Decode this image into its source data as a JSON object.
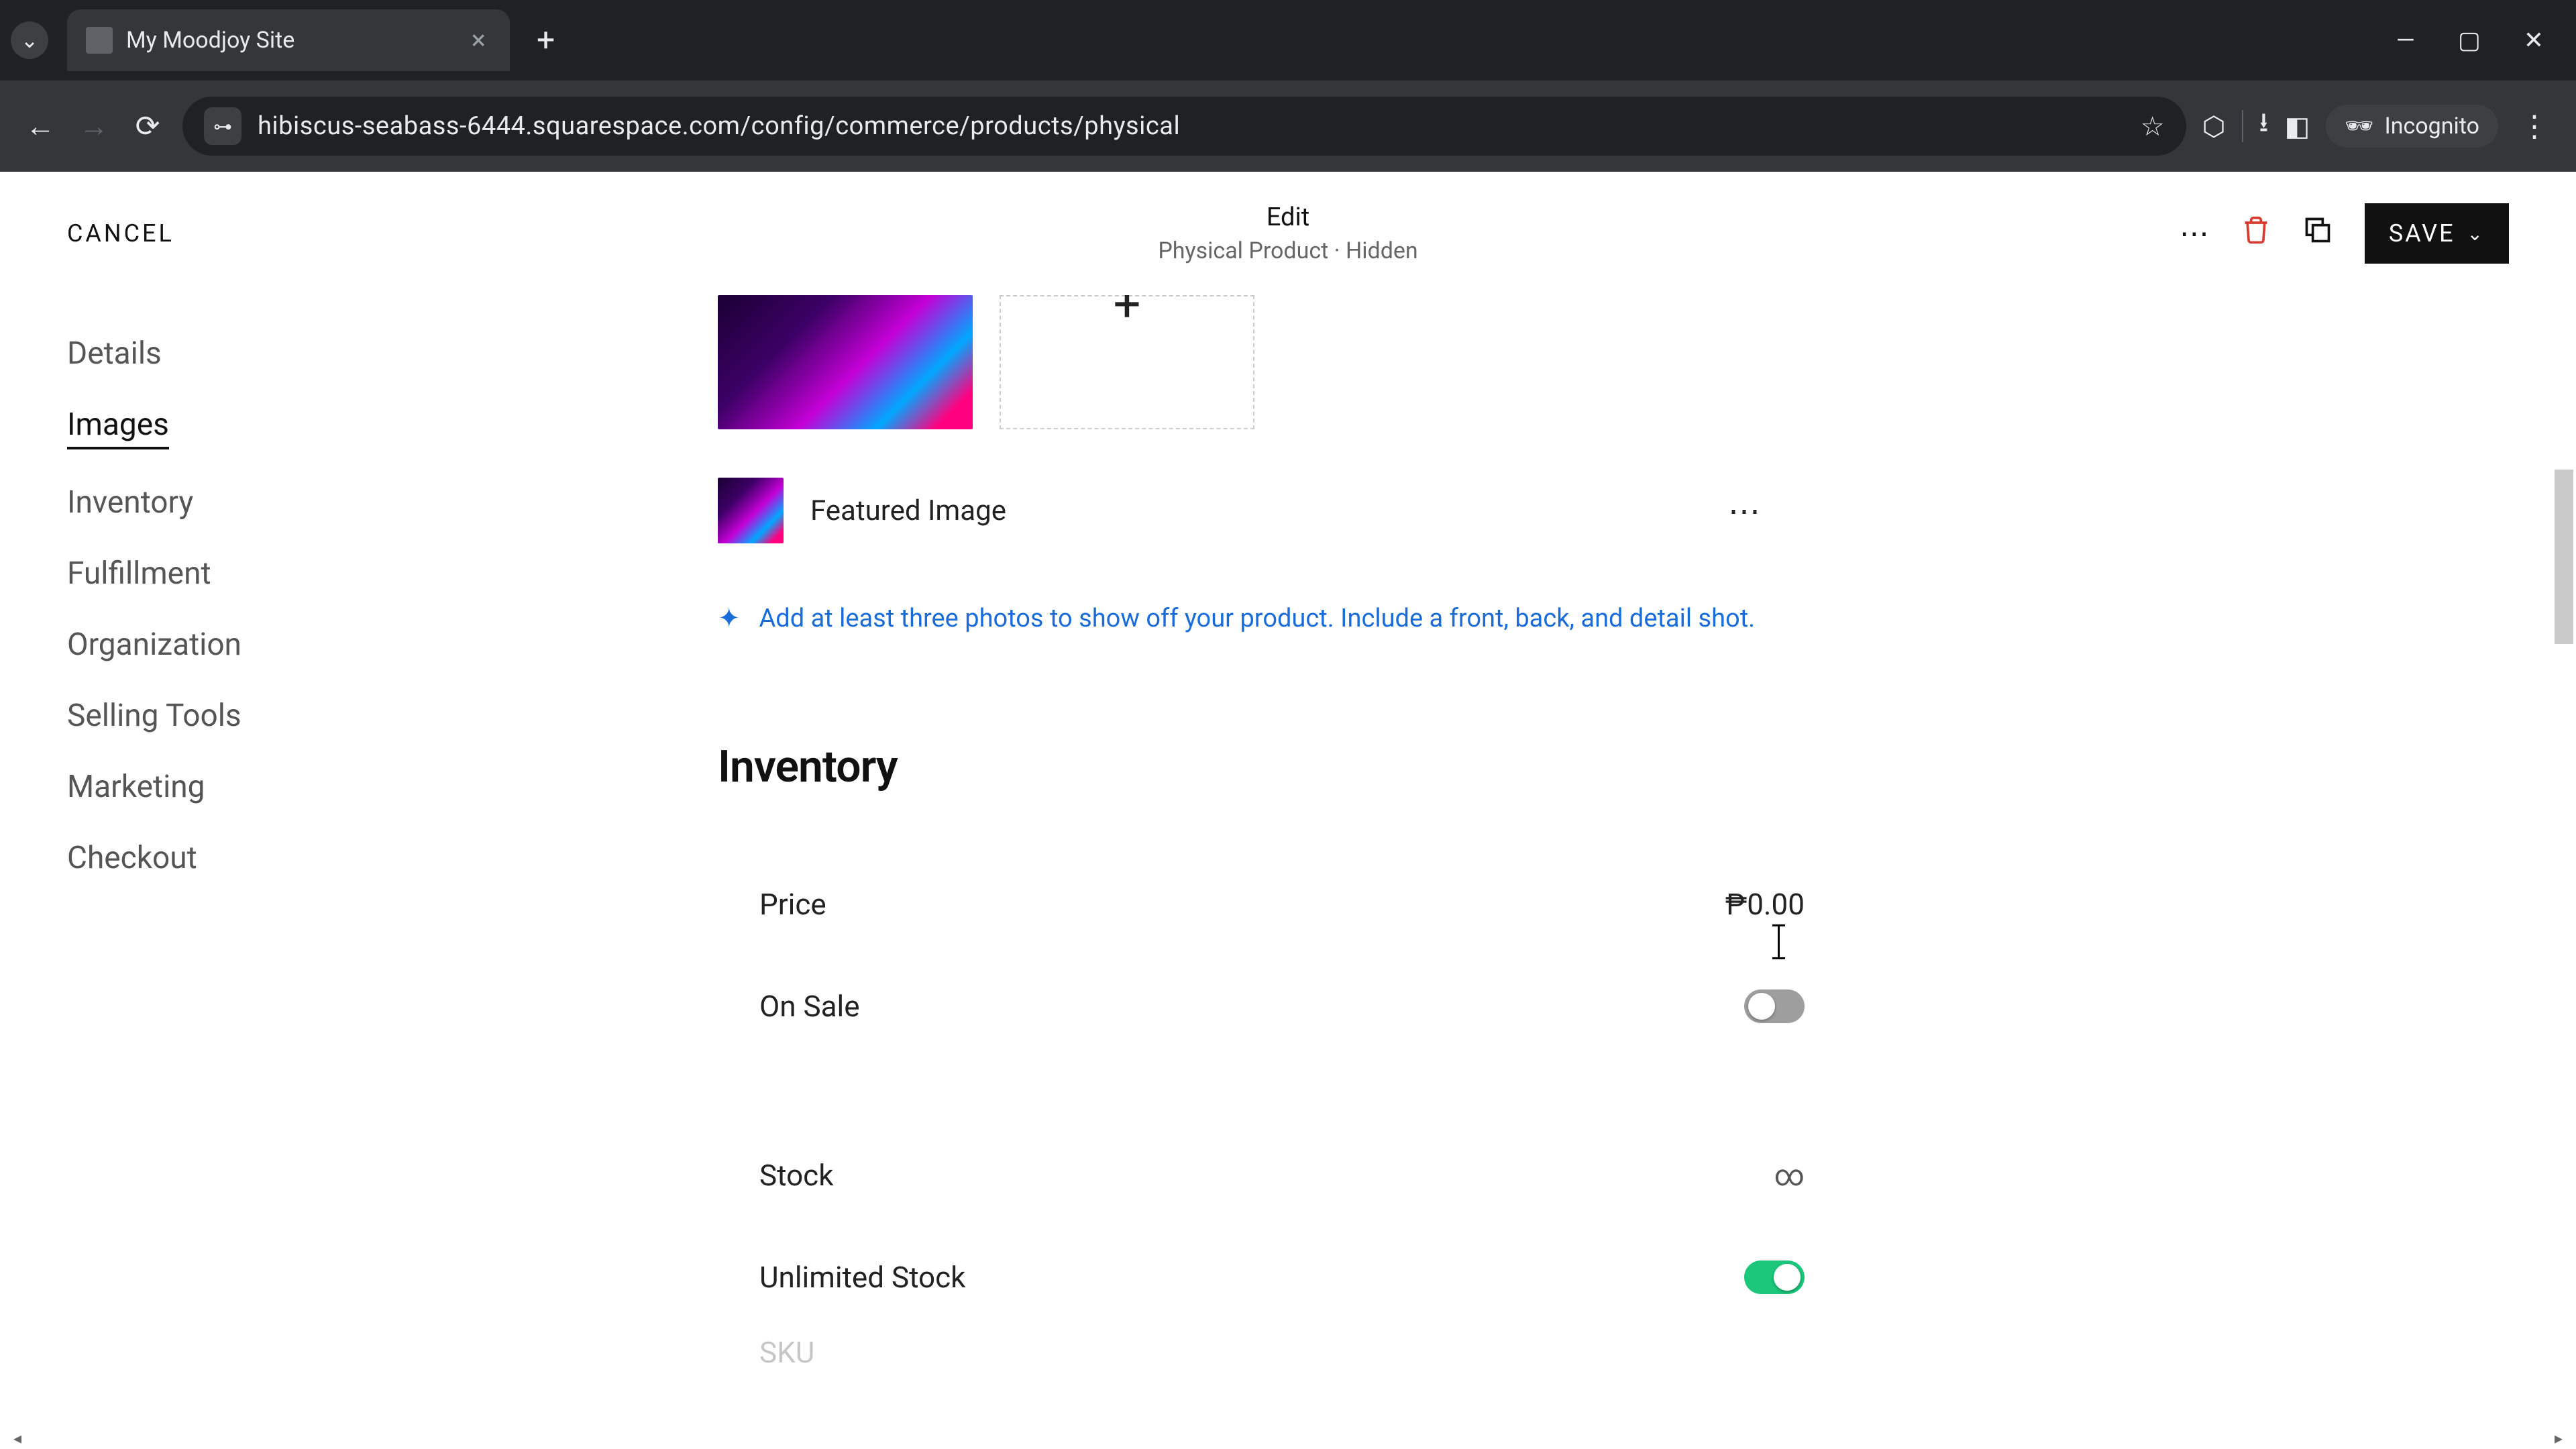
{
  "browser": {
    "tab_title": "My Moodjoy Site",
    "url": "hibiscus-seabass-6444.squarespace.com/config/commerce/products/physical",
    "incognito_label": "Incognito"
  },
  "header": {
    "cancel": "CANCEL",
    "title": "Edit",
    "subtitle": "Physical Product · Hidden",
    "save": "SAVE"
  },
  "sidebar": {
    "items": [
      {
        "label": "Details"
      },
      {
        "label": "Images"
      },
      {
        "label": "Inventory"
      },
      {
        "label": "Fulfillment"
      },
      {
        "label": "Organization"
      },
      {
        "label": "Selling Tools"
      },
      {
        "label": "Marketing"
      },
      {
        "label": "Checkout"
      }
    ],
    "active_index": 1
  },
  "images_section": {
    "featured_label": "Featured Image",
    "hint": "Add at least three photos to show off your product. Include a front, back, and detail shot."
  },
  "inventory": {
    "title": "Inventory",
    "price_label": "Price",
    "price_value": "₱0.00",
    "on_sale_label": "On Sale",
    "on_sale": false,
    "stock_label": "Stock",
    "stock_value": "∞",
    "unlimited_label": "Unlimited Stock",
    "unlimited": true,
    "sku_label_partial": "SKU"
  },
  "colors": {
    "link_blue": "#1a6dd8",
    "toggle_on": "#1cc67b",
    "trash_red": "#d73a2f"
  }
}
